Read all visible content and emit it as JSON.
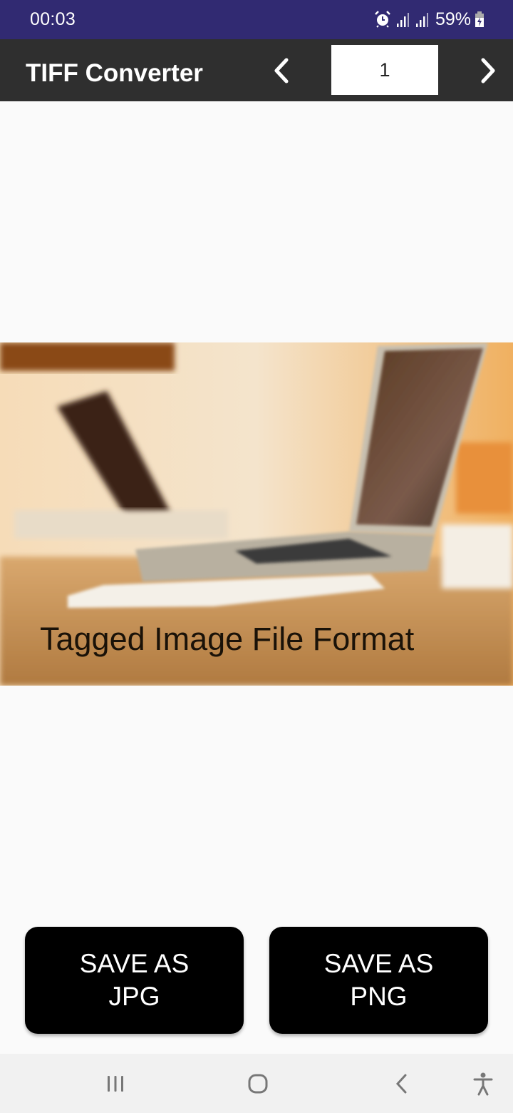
{
  "status_bar": {
    "time": "00:03",
    "battery_percent": "59%",
    "icons": [
      "alarm-icon",
      "signal-icon",
      "signal-icon",
      "battery-charging-icon"
    ]
  },
  "app_bar": {
    "title": "TIFF Converter",
    "prev_icon": "chevron-left-icon",
    "next_icon": "chevron-right-icon",
    "page_number": "1"
  },
  "preview": {
    "caption": "Tagged Image File Format",
    "description": "Blurred photo of laptops on a wooden desk"
  },
  "actions": {
    "save_jpg_label": "SAVE AS JPG",
    "save_png_label": "SAVE AS PNG"
  },
  "system_nav": {
    "recents": "recents-icon",
    "home": "home-icon",
    "back": "back-icon",
    "accessibility": "accessibility-icon"
  },
  "colors": {
    "status_bar": "#312a72",
    "app_bar": "#2f2f2f",
    "button": "#000000",
    "background": "#fafafa"
  }
}
